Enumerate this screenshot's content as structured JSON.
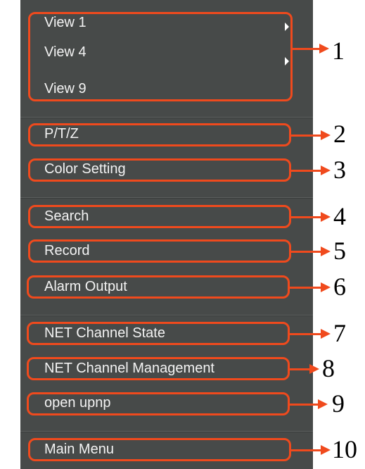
{
  "menu": {
    "view1": "View 1",
    "view4": "View 4",
    "view9": "View 9",
    "ptz": "P/T/Z",
    "color_setting": "Color Setting",
    "search": "Search",
    "record": "Record",
    "alarm_output": "Alarm Output",
    "net_channel_state": "NET Channel State",
    "net_channel_management": "NET Channel Management",
    "open_upnp": "open upnp",
    "main_menu": "Main Menu"
  },
  "callouts": [
    "1",
    "2",
    "3",
    "4",
    "5",
    "6",
    "7",
    "8",
    "9",
    "10"
  ],
  "colors": {
    "panel": "#474a49",
    "highlight_box": "#f04a1d",
    "text": "#f3f3f3"
  }
}
